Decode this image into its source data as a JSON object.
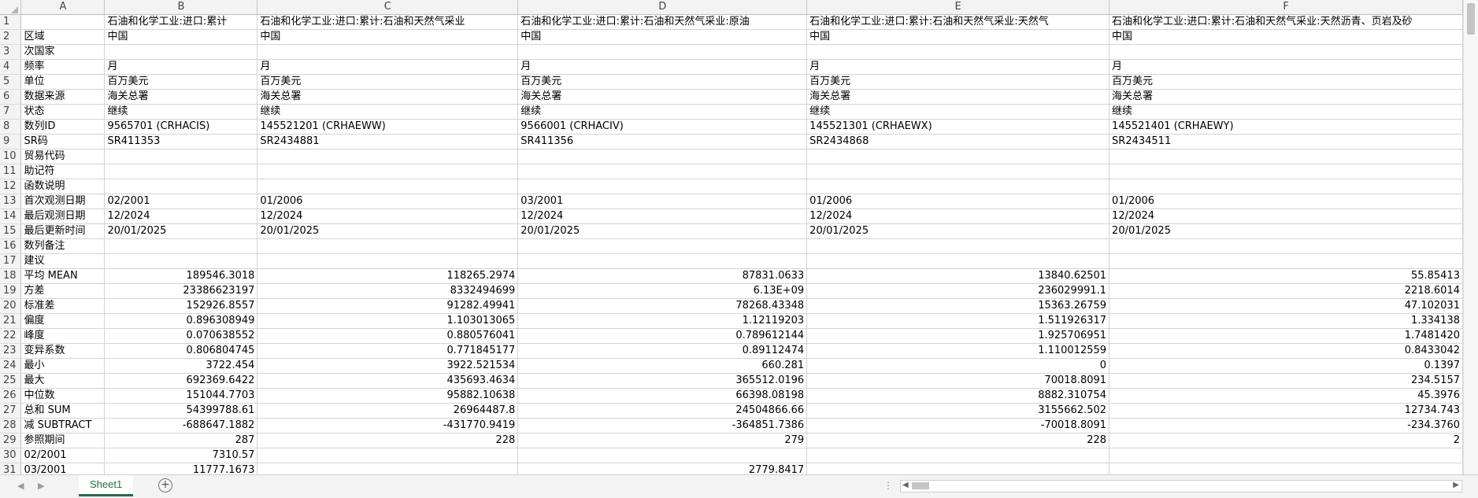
{
  "columns": [
    "A",
    "B",
    "C",
    "D",
    "E",
    "F"
  ],
  "rows": [
    {
      "n": "1",
      "a": "",
      "b": "石油和化学工业:进口:累计",
      "c": "石油和化学工业:进口:累计:石油和天然气采业",
      "d": "石油和化学工业:进口:累计:石油和天然气采业:原油",
      "e": "石油和化学工业:进口:累计:石油和天然气采业:天然气",
      "f": "石油和化学工业:进口:累计:石油和天然气采业:天然沥青、页岩及砂"
    },
    {
      "n": "2",
      "a": "区域",
      "b": "中国",
      "c": "中国",
      "d": "中国",
      "e": "中国",
      "f": "中国"
    },
    {
      "n": "3",
      "a": "次国家",
      "b": "",
      "c": "",
      "d": "",
      "e": "",
      "f": ""
    },
    {
      "n": "4",
      "a": "频率",
      "b": "月",
      "c": "月",
      "d": "月",
      "e": "月",
      "f": "月"
    },
    {
      "n": "5",
      "a": "单位",
      "b": "百万美元",
      "c": "百万美元",
      "d": "百万美元",
      "e": "百万美元",
      "f": "百万美元"
    },
    {
      "n": "6",
      "a": "数据来源",
      "b": "海关总署",
      "c": "海关总署",
      "d": "海关总署",
      "e": "海关总署",
      "f": "海关总署"
    },
    {
      "n": "7",
      "a": "状态",
      "b": "继续",
      "c": "继续",
      "d": "继续",
      "e": "继续",
      "f": "继续"
    },
    {
      "n": "8",
      "a": "数列ID",
      "b": "9565701 (CRHACIS)",
      "c": "145521201 (CRHAEWW)",
      "d": "9566001 (CRHACIV)",
      "e": "145521301 (CRHAEWX)",
      "f": "145521401 (CRHAEWY)"
    },
    {
      "n": "9",
      "a": "SR码",
      "b": "SR411353",
      "c": "SR2434881",
      "d": "SR411356",
      "e": "SR2434868",
      "f": "SR2434511"
    },
    {
      "n": "10",
      "a": "贸易代码",
      "b": "",
      "c": "",
      "d": "",
      "e": "",
      "f": ""
    },
    {
      "n": "11",
      "a": "助记符",
      "b": "",
      "c": "",
      "d": "",
      "e": "",
      "f": ""
    },
    {
      "n": "12",
      "a": "函数说明",
      "b": "",
      "c": "",
      "d": "",
      "e": "",
      "f": ""
    },
    {
      "n": "13",
      "a": "首次观测日期",
      "b": "02/2001",
      "c": "01/2006",
      "d": "03/2001",
      "e": "01/2006",
      "f": "01/2006"
    },
    {
      "n": "14",
      "a": "最后观测日期",
      "b": "12/2024",
      "c": "12/2024",
      "d": "12/2024",
      "e": "12/2024",
      "f": "12/2024"
    },
    {
      "n": "15",
      "a": "最后更新时间",
      "b": "20/01/2025",
      "c": "20/01/2025",
      "d": "20/01/2025",
      "e": "20/01/2025",
      "f": "20/01/2025"
    },
    {
      "n": "16",
      "a": "数列备注",
      "b": "",
      "c": "",
      "d": "",
      "e": "",
      "f": ""
    },
    {
      "n": "17",
      "a": "建议",
      "b": "",
      "c": "",
      "d": "",
      "e": "",
      "f": ""
    },
    {
      "n": "18",
      "a": "平均 MEAN",
      "b": "189546.3018",
      "c": "118265.2974",
      "d": "87831.0633",
      "e": "13840.62501",
      "f": "55.85413"
    },
    {
      "n": "19",
      "a": "方差",
      "b": "23386623197",
      "c": "8332494699",
      "d": "6.13E+09",
      "e": "236029991.1",
      "f": "2218.6014"
    },
    {
      "n": "20",
      "a": "标准差",
      "b": "152926.8557",
      "c": "91282.49941",
      "d": "78268.43348",
      "e": "15363.26759",
      "f": "47.102031"
    },
    {
      "n": "21",
      "a": "偏度",
      "b": "0.896308949",
      "c": "1.103013065",
      "d": "1.12119203",
      "e": "1.511926317",
      "f": "1.334138"
    },
    {
      "n": "22",
      "a": "峰度",
      "b": "0.070638552",
      "c": "0.880576041",
      "d": "0.789612144",
      "e": "1.925706951",
      "f": "1.7481420"
    },
    {
      "n": "23",
      "a": "变异系数",
      "b": "0.806804745",
      "c": "0.771845177",
      "d": "0.89112474",
      "e": "1.110012559",
      "f": "0.8433042"
    },
    {
      "n": "24",
      "a": "最小",
      "b": "3722.454",
      "c": "3922.521534",
      "d": "660.281",
      "e": "0",
      "f": "0.1397"
    },
    {
      "n": "25",
      "a": "最大",
      "b": "692369.6422",
      "c": "435693.4634",
      "d": "365512.0196",
      "e": "70018.8091",
      "f": "234.5157"
    },
    {
      "n": "26",
      "a": "中位数",
      "b": "151044.7703",
      "c": "95882.10638",
      "d": "66398.08198",
      "e": "8882.310754",
      "f": "45.3976"
    },
    {
      "n": "27",
      "a": "总和 SUM",
      "b": "54399788.61",
      "c": "26964487.8",
      "d": "24504866.66",
      "e": "3155662.502",
      "f": "12734.743"
    },
    {
      "n": "28",
      "a": "减 SUBTRACT",
      "b": "-688647.1882",
      "c": "-431770.9419",
      "d": "-364851.7386",
      "e": "-70018.8091",
      "f": "-234.3760"
    },
    {
      "n": "29",
      "a": "参照期间",
      "b": "287",
      "c": "228",
      "d": "279",
      "e": "228",
      "f": "2"
    },
    {
      "n": "30",
      "a": "02/2001",
      "b": "7310.57",
      "c": "",
      "d": "",
      "e": "",
      "f": ""
    },
    {
      "n": "31",
      "a": "03/2001",
      "b": "11777.1673",
      "c": "",
      "d": "2779.8417",
      "e": "",
      "f": ""
    }
  ],
  "bottom": {
    "sheet_tab": "Sheet1",
    "add_sheet": "+",
    "prev": "◀",
    "next": "▶",
    "dots": "⋮"
  }
}
